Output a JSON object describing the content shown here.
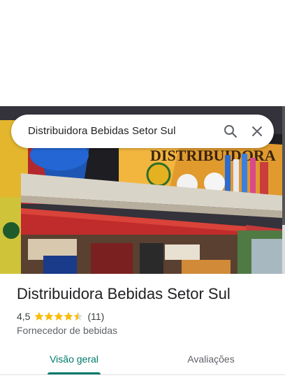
{
  "search": {
    "query": "Distribuidora Bebidas Setor Sul",
    "search_icon": "search-icon",
    "close_icon": "close-icon"
  },
  "photo": {
    "sign_text": "DISTRIBUIDORA",
    "description_icon": "storefront-photo"
  },
  "place": {
    "name": "Distribuidora Bebidas Setor Sul",
    "rating": "4,5",
    "rating_value": 4.5,
    "stars_total": 5,
    "review_count": "(11)",
    "category": "Fornecedor de bebidas"
  },
  "tabs": [
    {
      "label": "Visão geral",
      "selected": true
    },
    {
      "label": "Avaliações",
      "selected": false
    }
  ],
  "colors": {
    "accent": "#00796b",
    "star": "#fbbc04",
    "text_primary": "#202124",
    "text_secondary": "#5f6368"
  }
}
